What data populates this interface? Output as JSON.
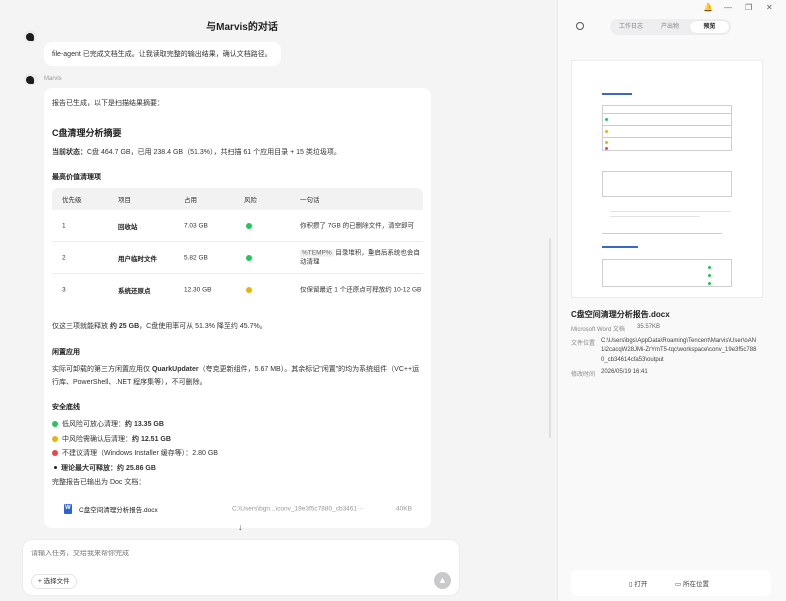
{
  "conversation": {
    "title": "与Marvis的对话",
    "user_message": "file-agent 已完成文档生成。让我读取完整的输出结果，确认文档路径。",
    "assistant_name": "Marvis",
    "intro": "报告已生成，以下是扫描结果摘要：",
    "report_title": "C盘清理分析摘要",
    "status_label": "当前状态：",
    "status_text": "C盘 464.7 GB，已用 238.4 GB（51.3%），共扫描 61 个应用目录 + 15 类垃圾项。",
    "section_items": "最高价值清理项",
    "table": {
      "headers": [
        "优先级",
        "项目",
        "占用",
        "风险",
        "一句话"
      ],
      "rows": [
        {
          "priority": "1",
          "item": "回收站",
          "size": "7.03 GB",
          "risk_color": "#22c55e",
          "note": "你积攒了 7GB 的已删除文件，清空即可"
        },
        {
          "priority": "2",
          "item": "用户临时文件",
          "size": "5.82 GB",
          "risk_color": "#22c55e",
          "note_code": "%TEMP%",
          "note": " 目录堆积，重启后系统也会自动清理"
        },
        {
          "priority": "3",
          "item": "系统还原点",
          "size": "12.30 GB",
          "risk_color": "#eab308",
          "note": "仅保留最近 1 个还原点可释放约 10-12 GB"
        }
      ]
    },
    "summary_pre": "仅这三项就能释放 ",
    "summary_bold": "约 25 GB",
    "summary_post": "，C盘使用率可从 51.3% 降至约 45.7%。",
    "section_idle": "闲置应用",
    "idle_line1_pre": "实际可卸载的第三方闲置应用仅 ",
    "idle_line1_bold": "QuarkUpdater",
    "idle_line1_post": "（夸克更新组件，5.67 MB）。其余标记\"闲置\"的均为系统组件（VC++运",
    "idle_line2": "行库、PowerShell、.NET 程序集等），不可删除。",
    "section_safety": "安全底线",
    "safety": [
      {
        "color": "#22c55e",
        "pre": "低风险可放心清理：",
        "bold": "约 13.35 GB"
      },
      {
        "color": "#eab308",
        "pre": "中风险需确认后清理：",
        "bold": "约 12.51 GB"
      },
      {
        "color": "#ef4444",
        "pre": "不建议清理（Windows Installer 缓存等）：2.80 GB",
        "bold": ""
      }
    ],
    "safety_total_pre": "理论最大可释放：",
    "safety_total_bold": "约 25.86 GB",
    "export_text": "完整报告已输出为 Doc 文档：",
    "file": {
      "name": "C盘空间清理分析报告.docx",
      "path": "C:\\Users\\bgn...\\conv_19e3f5c7880_cb3461···",
      "size": "40KB"
    }
  },
  "input": {
    "placeholder": "请输入任务，交给我来帮你完成",
    "pick_label": "选择文件",
    "send_icon": "arrow-up-icon"
  },
  "panel": {
    "tabs": [
      "工作日志",
      "产出物",
      "预览"
    ],
    "active_tab": "预览",
    "file_name": "C盘空间清理分析报告.docx",
    "file_type": "Microsoft Word 文档",
    "file_size": "35.57KB",
    "path_label": "文件位置",
    "path_value_l1": "C:\\Users\\bgs\\AppData\\Roaming\\Tencent\\Marvis\\User\\oAN",
    "path_value_l2": "1i2cacqW28JMi-ZrYmT5-tqc\\workspace\\conv_19e3f5c788",
    "path_value_l3": "0_cb34614cfa53\\output",
    "mtime_label": "修改时间",
    "mtime_value": "2026/05/19 16:41",
    "open_label": "打开",
    "folder_label": "所在位置"
  },
  "window": {
    "icons": [
      "bell-icon",
      "minimize-icon",
      "maximize-icon",
      "close-icon"
    ]
  },
  "colors": {
    "accent": "#2b62d9",
    "low_risk": "#22c55e",
    "mid_risk": "#eab308",
    "high_risk": "#ef4444"
  }
}
